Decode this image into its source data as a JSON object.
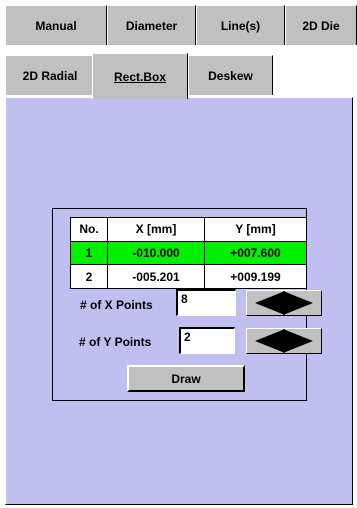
{
  "tabs_row1": [
    "Manual",
    "Diameter",
    "Line(s)",
    "2D Die"
  ],
  "tabs_row2": [
    "2D Radial",
    "Rect.Box",
    "Deskew"
  ],
  "selected_tab": "Rect.Box",
  "table": {
    "headers": [
      "No.",
      "X [mm]",
      "Y [mm]"
    ],
    "rows": [
      [
        "1",
        "-010.000",
        "+007.600"
      ],
      [
        "2",
        "-005.201",
        "+009.199"
      ]
    ],
    "highlight_row_color": "#00f000"
  },
  "x_points": {
    "label": "# of X Points",
    "value": "8"
  },
  "y_points": {
    "label": "# of Y Points",
    "value": "2"
  },
  "draw_label": "Draw",
  "colors": {
    "panel": "#c0c0f0",
    "tab": "#c0c0c0"
  }
}
